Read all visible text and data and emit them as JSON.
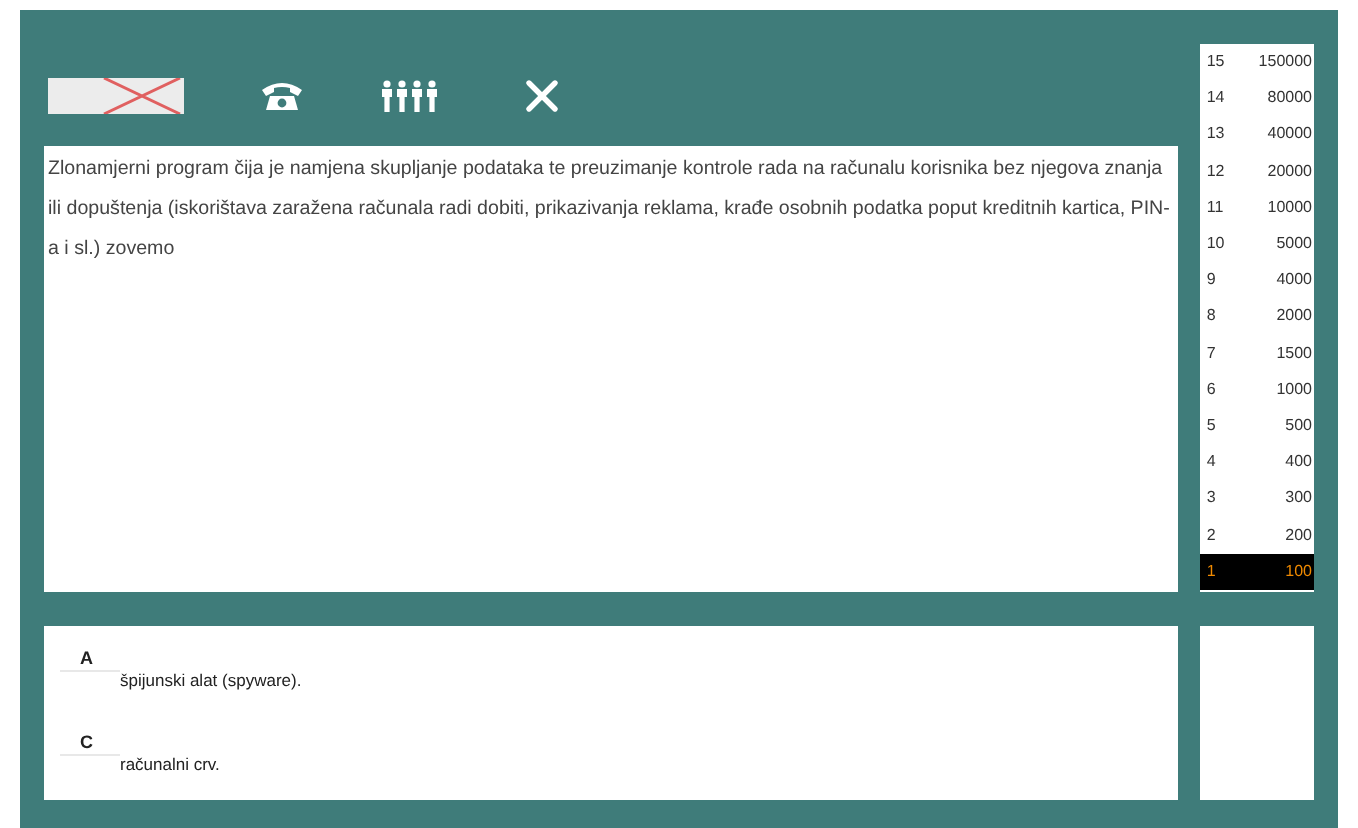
{
  "lifelines": [
    {
      "kind": "fifty",
      "used": true
    },
    {
      "kind": "phone",
      "used": false
    },
    {
      "kind": "audience",
      "used": false
    },
    {
      "kind": "quit",
      "used": false
    }
  ],
  "question": "Zlonamjerni program čija je namjena skupljanje podataka te preuzimanje kontrole rada na računalu korisnika bez njegova znanja ili dopuštenja (iskorištava zaražena računala radi dobiti, prikazivanja reklama, krađe osobnih podatka poput kreditnih kartica, PIN-a i sl.) zovemo",
  "ladder": [
    {
      "level": "15",
      "prize": "150000",
      "selected": false
    },
    {
      "level": "14",
      "prize": "80000",
      "selected": false
    },
    {
      "level": "13",
      "prize": "40000",
      "selected": false
    },
    {
      "level": "12",
      "prize": "20000",
      "selected": false
    },
    {
      "level": "11",
      "prize": "10000",
      "selected": false
    },
    {
      "level": "10",
      "prize": "5000",
      "selected": false
    },
    {
      "level": "9",
      "prize": "4000",
      "selected": false
    },
    {
      "level": "8",
      "prize": "2000",
      "selected": false
    },
    {
      "level": "7",
      "prize": "1500",
      "selected": false
    },
    {
      "level": "6",
      "prize": "1000",
      "selected": false
    },
    {
      "level": "5",
      "prize": "500",
      "selected": false
    },
    {
      "level": "4",
      "prize": "400",
      "selected": false
    },
    {
      "level": "3",
      "prize": "300",
      "selected": false
    },
    {
      "level": "2",
      "prize": "200",
      "selected": false
    },
    {
      "level": "1",
      "prize": "100",
      "selected": true
    }
  ],
  "answers": [
    {
      "letter": "A",
      "text": "špijunski alat (spyware)."
    },
    {
      "letter": "C",
      "text": "računalni crv."
    }
  ]
}
